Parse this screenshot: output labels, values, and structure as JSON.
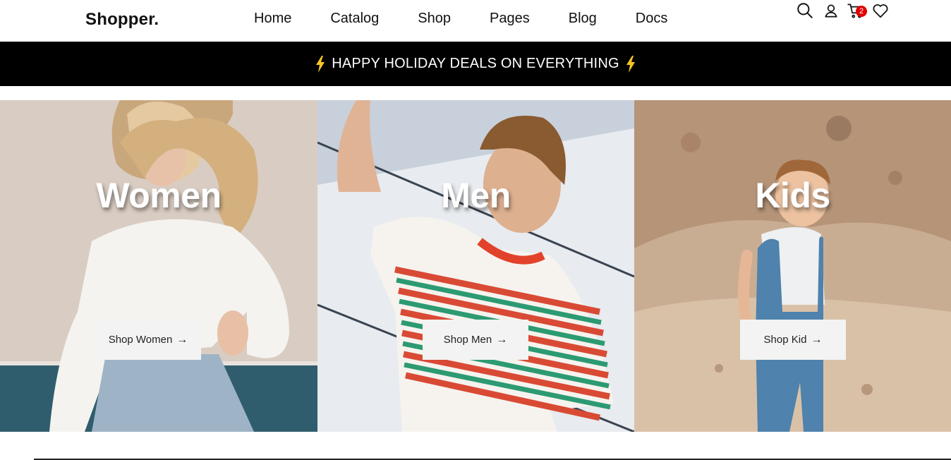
{
  "header": {
    "brand": "Shopper.",
    "nav": [
      {
        "label": "Home"
      },
      {
        "label": "Catalog"
      },
      {
        "label": "Shop"
      },
      {
        "label": "Pages"
      },
      {
        "label": "Blog"
      },
      {
        "label": "Docs"
      }
    ],
    "icons": [
      "search-icon",
      "user-icon",
      "cart-icon",
      "heart-icon"
    ],
    "cart_count": "2"
  },
  "promo": {
    "text": "HAPPY HOLIDAY DEALS ON EVERYTHING",
    "bolt_color": "#f6c423"
  },
  "categories": [
    {
      "title": "Women",
      "button": "Shop Women",
      "arrow": "→"
    },
    {
      "title": "Men",
      "button": "Shop Men",
      "arrow": "→"
    },
    {
      "title": "Kids",
      "button": "Shop Kid",
      "arrow": "→"
    }
  ],
  "colors": {
    "promo_bg": "#000000",
    "badge": "#e00000",
    "button_bg": "#f3f3f3"
  }
}
